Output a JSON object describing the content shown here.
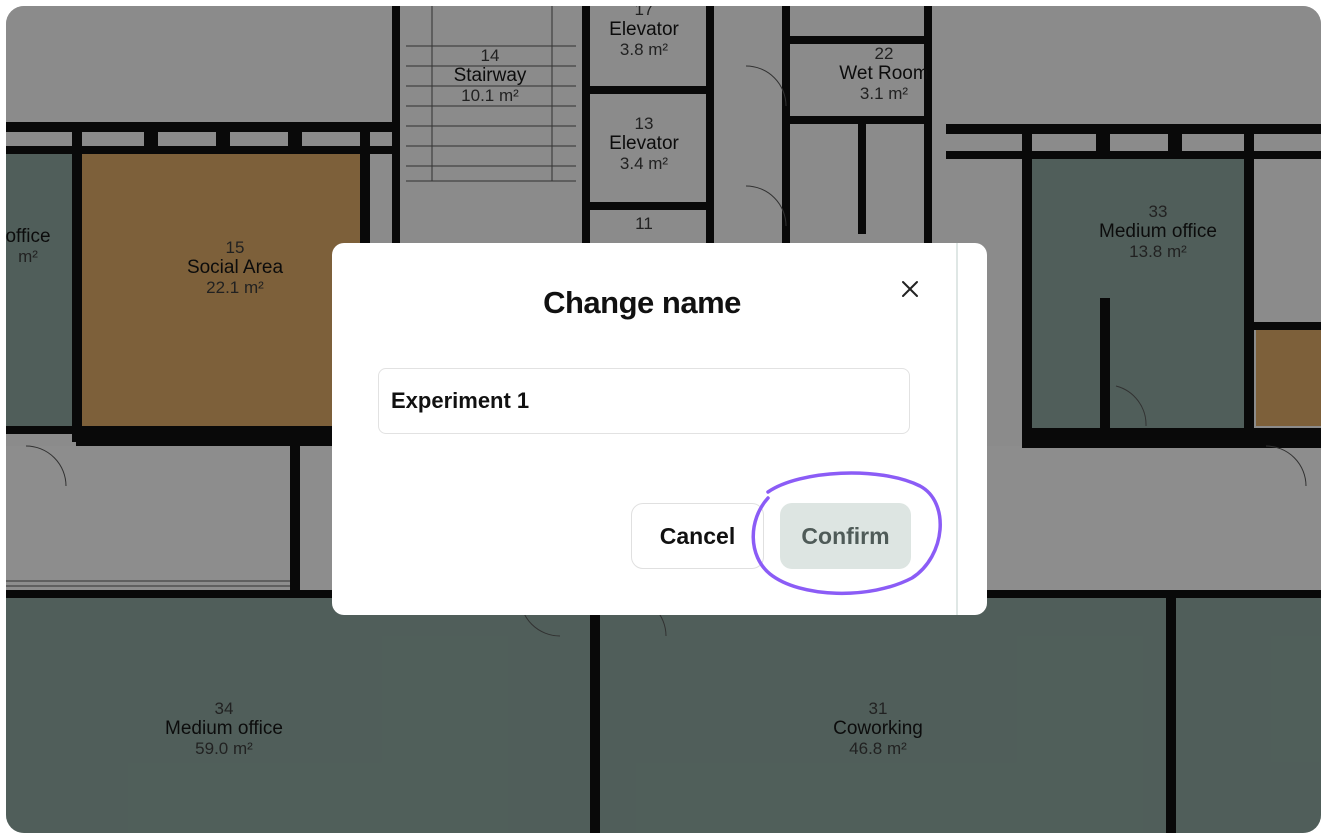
{
  "floor_plan": {
    "rooms": [
      {
        "id": "stairway",
        "number": "14",
        "name": "Stairway",
        "area": "10.1 m²"
      },
      {
        "id": "elevator-17",
        "number": "17",
        "name": "Elevator",
        "area": "3.8 m²"
      },
      {
        "id": "elevator-13",
        "number": "13",
        "name": "Elevator",
        "area": "3.4 m²"
      },
      {
        "id": "elevator-11",
        "number": "11",
        "name": "",
        "area": ""
      },
      {
        "id": "wet-room",
        "number": "22",
        "name": "Wet Room",
        "area": "3.1 m²"
      },
      {
        "id": "social-area",
        "number": "15",
        "name": "Social Area",
        "area": "22.1 m²"
      },
      {
        "id": "office-left",
        "number": "",
        "name": "office",
        "area": "m²"
      },
      {
        "id": "medium-office-33",
        "number": "33",
        "name": "Medium office",
        "area": "13.8 m²"
      },
      {
        "id": "medium-office-34",
        "number": "34",
        "name": "Medium office",
        "area": "59.0 m²"
      },
      {
        "id": "coworking",
        "number": "31",
        "name": "Coworking",
        "area": "46.8 m²"
      }
    ]
  },
  "dialog": {
    "title": "Change name",
    "close_icon": "close-icon",
    "input_value": "Experiment 1",
    "cancel_label": "Cancel",
    "confirm_label": "Confirm",
    "highlight_color": "#8b5cf6"
  }
}
